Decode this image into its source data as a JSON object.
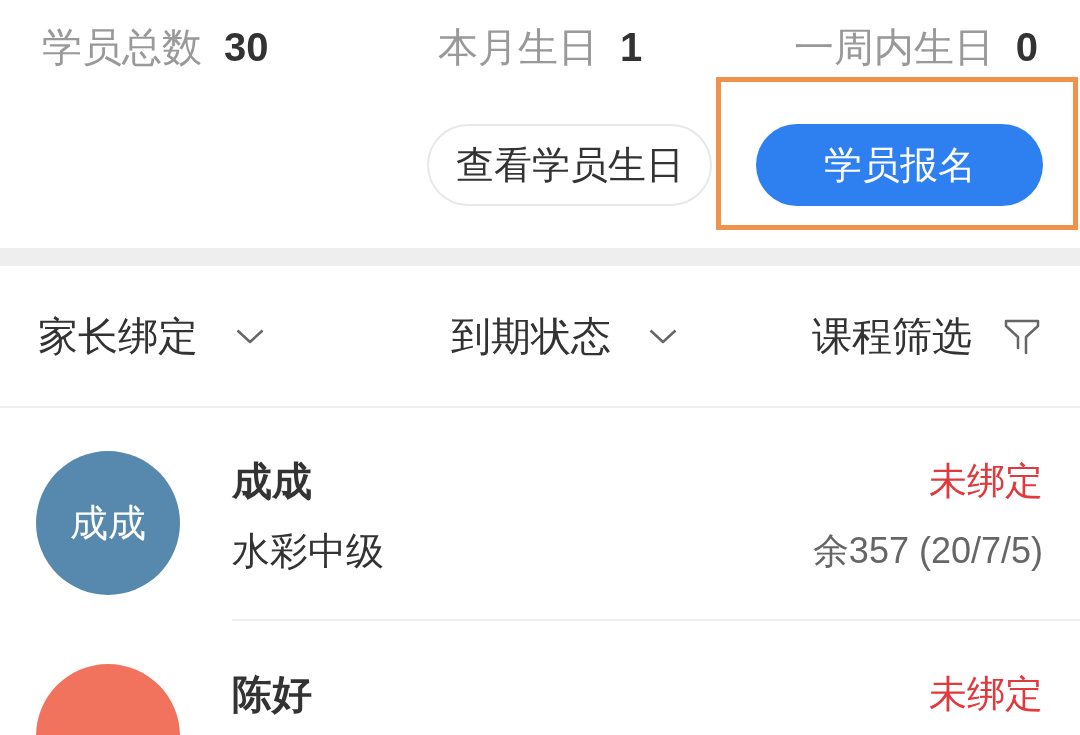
{
  "stats": [
    {
      "label": "学员总数",
      "value": "30"
    },
    {
      "label": "本月生日",
      "value": "1"
    },
    {
      "label": "一周内生日",
      "value": "0"
    }
  ],
  "actions": [
    {
      "label": "查看学员生日",
      "kind": "outline",
      "highlighted": false
    },
    {
      "label": "学员报名",
      "kind": "primary",
      "highlighted": true
    }
  ],
  "filters": [
    {
      "label": "家长绑定",
      "kind": "dropdown"
    },
    {
      "label": "到期状态",
      "kind": "dropdown"
    },
    {
      "label": "课程筛选",
      "kind": "filter"
    }
  ],
  "students": [
    {
      "name": "成成",
      "avatar_text": "成成",
      "color": "#5689ad",
      "status": "未绑定",
      "course": "水彩中级",
      "balance": "余357 (20/7/5)"
    },
    {
      "name": "陈好",
      "color": "#f2735d",
      "status": "未绑定"
    }
  ]
}
